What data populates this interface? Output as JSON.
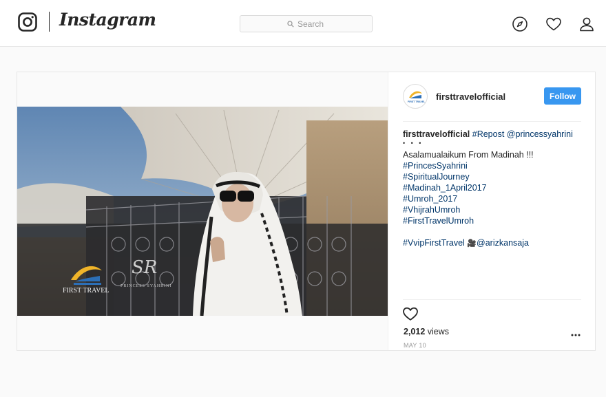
{
  "nav": {
    "logo_text": "Instagram",
    "search_placeholder": "Search",
    "icons": [
      "instagram-glyph-icon",
      "search-icon",
      "explore-compass-icon",
      "activity-heart-icon",
      "profile-person-icon"
    ]
  },
  "post": {
    "username": "firsttravelofficial",
    "follow_label": "Follow",
    "caption": {
      "user": "firsttravelofficial",
      "repost_tag": "#Repost",
      "mention": "@princessyahrini",
      "dots": "• • •",
      "greeting": "Asalamualaikum From Madinah !!!",
      "hashtags": [
        "#PrincesSyahrini",
        "#SpiritualJourney",
        "#Madinah_1April2017",
        "#Umroh_2017",
        "#VhijrahUmroh",
        "#FirstTravelUmroh"
      ],
      "final_tag": "#VvipFirstTravel",
      "camera_glyph": "🎥",
      "final_mention": "@arizkansaja"
    },
    "views_count": "2,012",
    "views_label": "views",
    "date": "MAY 10",
    "video": {
      "logo_text": "FIRST TRAVEL",
      "watermark_monogram": "SR",
      "watermark_text": "PRINCESS SYAHRINI"
    },
    "avatar_text": "FIRST TRAVEL",
    "icons": [
      "like-heart-icon",
      "more-options-icon"
    ]
  },
  "colors": {
    "accent_blue": "#3897f0",
    "hashtag_blue": "#003569",
    "text_dark": "#262626",
    "muted_gray": "#999999",
    "border_gray": "#e6e6e6"
  }
}
